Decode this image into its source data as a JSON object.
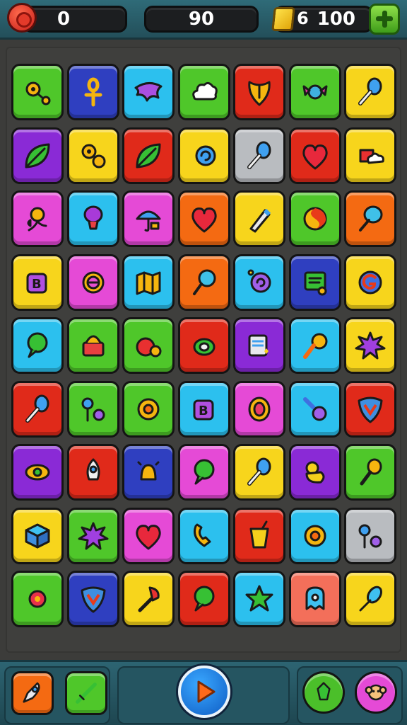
{
  "hud": {
    "score_left": "0",
    "score_center": "90",
    "coins_prefix": "6",
    "coins": "100"
  },
  "colors": {
    "green": "#4fc72a",
    "blue": "#2f3fc0",
    "cyan": "#2cc0ee",
    "red": "#e02a1a",
    "yellow": "#f7d51c",
    "purple": "#8a2ad6",
    "pink": "#e54ad6",
    "orange": "#f46a12",
    "gray": "#b9bcc0",
    "salmon": "#f36f5a"
  },
  "board": {
    "rows": [
      [
        {
          "c": "green",
          "icon": "key-gear"
        },
        {
          "c": "blue",
          "icon": "ankh"
        },
        {
          "c": "cyan",
          "icon": "bat-wing"
        },
        {
          "c": "green",
          "icon": "cloud"
        },
        {
          "c": "red",
          "icon": "shield-heart"
        },
        {
          "c": "green",
          "icon": "candy"
        },
        {
          "c": "yellow",
          "icon": "racket"
        }
      ],
      [
        {
          "c": "purple",
          "icon": "leaf"
        },
        {
          "c": "yellow",
          "icon": "gears"
        },
        {
          "c": "red",
          "icon": "leaf"
        },
        {
          "c": "yellow",
          "icon": "swirl"
        },
        {
          "c": "gray",
          "icon": "racket"
        },
        {
          "c": "red",
          "icon": "heart"
        },
        {
          "c": "yellow",
          "icon": "gift-cloud"
        }
      ],
      [
        {
          "c": "pink",
          "icon": "flower"
        },
        {
          "c": "cyan",
          "icon": "balloon"
        },
        {
          "c": "pink",
          "icon": "umbrella"
        },
        {
          "c": "orange",
          "icon": "heart"
        },
        {
          "c": "yellow",
          "icon": "marker"
        },
        {
          "c": "green",
          "icon": "yin"
        },
        {
          "c": "orange",
          "icon": "cotton-candy"
        }
      ],
      [
        {
          "c": "yellow",
          "icon": "block-b"
        },
        {
          "c": "pink",
          "icon": "spiral-e"
        },
        {
          "c": "cyan",
          "icon": "map"
        },
        {
          "c": "orange",
          "icon": "lollipop"
        },
        {
          "c": "cyan",
          "icon": "snail"
        },
        {
          "c": "blue",
          "icon": "note"
        },
        {
          "c": "yellow",
          "icon": "spiral-g"
        }
      ],
      [
        {
          "c": "cyan",
          "icon": "bubble"
        },
        {
          "c": "green",
          "icon": "basket"
        },
        {
          "c": "green",
          "icon": "apple"
        },
        {
          "c": "red",
          "icon": "turtle"
        },
        {
          "c": "purple",
          "icon": "card"
        },
        {
          "c": "cyan",
          "icon": "sun-cone"
        },
        {
          "c": "yellow",
          "icon": "splat"
        }
      ],
      [
        {
          "c": "red",
          "icon": "racket"
        },
        {
          "c": "green",
          "icon": "key-circle"
        },
        {
          "c": "green",
          "icon": "gear"
        },
        {
          "c": "cyan",
          "icon": "block-b"
        },
        {
          "c": "pink",
          "icon": "ring"
        },
        {
          "c": "cyan",
          "icon": "rattle"
        },
        {
          "c": "red",
          "icon": "shield-v"
        }
      ],
      [
        {
          "c": "purple",
          "icon": "eye-leaf"
        },
        {
          "c": "red",
          "icon": "rocket"
        },
        {
          "c": "blue",
          "icon": "bell-sparkle"
        },
        {
          "c": "pink",
          "icon": "bubble"
        },
        {
          "c": "yellow",
          "icon": "racket"
        },
        {
          "c": "purple",
          "icon": "duck"
        },
        {
          "c": "green",
          "icon": "maraca"
        }
      ],
      [
        {
          "c": "yellow",
          "icon": "box"
        },
        {
          "c": "green",
          "icon": "splat"
        },
        {
          "c": "pink",
          "icon": "heart"
        },
        {
          "c": "cyan",
          "icon": "phone"
        },
        {
          "c": "red",
          "icon": "drink"
        },
        {
          "c": "cyan",
          "icon": "gear"
        },
        {
          "c": "gray",
          "icon": "key-circle"
        }
      ],
      [
        {
          "c": "green",
          "icon": "sun-star"
        },
        {
          "c": "blue",
          "icon": "shield-v"
        },
        {
          "c": "yellow",
          "icon": "plunger"
        },
        {
          "c": "red",
          "icon": "bubble"
        },
        {
          "c": "cyan",
          "icon": "star"
        },
        {
          "c": "salmon",
          "icon": "ghost"
        },
        {
          "c": "yellow",
          "icon": "feather"
        }
      ]
    ]
  },
  "bottom": {
    "left_buttons": [
      {
        "c": "orange",
        "icon": "rocket-ship"
      },
      {
        "c": "green",
        "icon": "sword"
      }
    ],
    "right_buttons": [
      {
        "c": "#4bbf2a",
        "icon": "star-badge"
      },
      {
        "c": "#e54ad6",
        "icon": "monkey-face"
      }
    ]
  }
}
